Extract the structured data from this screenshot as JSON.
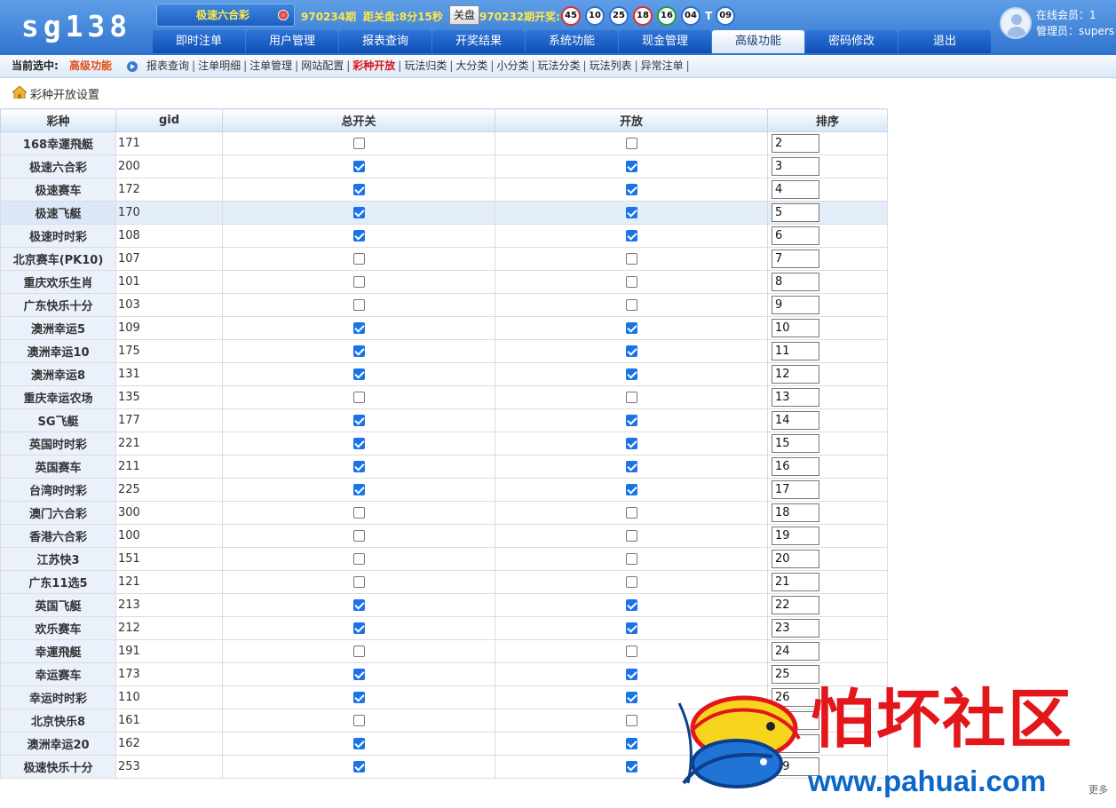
{
  "header": {
    "logo": "sg138",
    "current_game": "极速六合彩",
    "period": "970234期",
    "countdown": "距关盘:8分15秒",
    "close_button": "关盘",
    "last_draw_label": "970232期开奖:",
    "balls": [
      {
        "num": "45",
        "color": "red"
      },
      {
        "num": "10",
        "color": "blue"
      },
      {
        "num": "25",
        "color": "blue"
      },
      {
        "num": "18",
        "color": "red"
      },
      {
        "num": "16",
        "color": "green"
      },
      {
        "num": "04",
        "color": "blue"
      }
    ],
    "special_sep": "T",
    "special_ball": {
      "num": "09",
      "color": "blue"
    },
    "nav": [
      "即时注单",
      "用户管理",
      "报表查询",
      "开奖结果",
      "系统功能",
      "现金管理",
      "高级功能",
      "密码修改",
      "退出"
    ],
    "nav_active": "高级功能",
    "online_members": "在线会员：1",
    "admin": "管理员：supers"
  },
  "subbar": {
    "current_label": "当前选中:",
    "current_value": "高级功能",
    "links": [
      "报表查询",
      "注单明细",
      "注单管理",
      "网站配置",
      "彩种开放",
      "玩法归类",
      "大分类",
      "小分类",
      "玩法分类",
      "玩法列表",
      "异常注单"
    ],
    "active_link": "彩种开放"
  },
  "page": {
    "title": "彩种开放设置"
  },
  "table": {
    "headers": [
      "彩种",
      "gid",
      "总开关",
      "开放",
      "排序"
    ],
    "rows": [
      {
        "name": "168幸運飛艇",
        "gid": "171",
        "master": false,
        "open": false,
        "sort": "2"
      },
      {
        "name": "极速六合彩",
        "gid": "200",
        "master": true,
        "open": true,
        "sort": "3"
      },
      {
        "name": "极速赛车",
        "gid": "172",
        "master": true,
        "open": true,
        "sort": "4"
      },
      {
        "name": "极速飞艇",
        "gid": "170",
        "master": true,
        "open": true,
        "sort": "5"
      },
      {
        "name": "极速时时彩",
        "gid": "108",
        "master": true,
        "open": true,
        "sort": "6"
      },
      {
        "name": "北京赛车(PK10)",
        "gid": "107",
        "master": false,
        "open": false,
        "sort": "7"
      },
      {
        "name": "重庆欢乐生肖",
        "gid": "101",
        "master": false,
        "open": false,
        "sort": "8"
      },
      {
        "name": "广东快乐十分",
        "gid": "103",
        "master": false,
        "open": false,
        "sort": "9"
      },
      {
        "name": "澳洲幸运5",
        "gid": "109",
        "master": true,
        "open": true,
        "sort": "10"
      },
      {
        "name": "澳洲幸运10",
        "gid": "175",
        "master": true,
        "open": true,
        "sort": "11"
      },
      {
        "name": "澳洲幸运8",
        "gid": "131",
        "master": true,
        "open": true,
        "sort": "12"
      },
      {
        "name": "重庆幸运农场",
        "gid": "135",
        "master": false,
        "open": false,
        "sort": "13"
      },
      {
        "name": "SG飞艇",
        "gid": "177",
        "master": true,
        "open": true,
        "sort": "14"
      },
      {
        "name": "英国时时彩",
        "gid": "221",
        "master": true,
        "open": true,
        "sort": "15"
      },
      {
        "name": "英国赛车",
        "gid": "211",
        "master": true,
        "open": true,
        "sort": "16"
      },
      {
        "name": "台湾时时彩",
        "gid": "225",
        "master": true,
        "open": true,
        "sort": "17"
      },
      {
        "name": "澳门六合彩",
        "gid": "300",
        "master": false,
        "open": false,
        "sort": "18"
      },
      {
        "name": "香港六合彩",
        "gid": "100",
        "master": false,
        "open": false,
        "sort": "19"
      },
      {
        "name": "江苏快3",
        "gid": "151",
        "master": false,
        "open": false,
        "sort": "20"
      },
      {
        "name": "广东11选5",
        "gid": "121",
        "master": false,
        "open": false,
        "sort": "21"
      },
      {
        "name": "英国飞艇",
        "gid": "213",
        "master": true,
        "open": true,
        "sort": "22"
      },
      {
        "name": "欢乐赛车",
        "gid": "212",
        "master": true,
        "open": true,
        "sort": "23"
      },
      {
        "name": "幸運飛艇",
        "gid": "191",
        "master": false,
        "open": false,
        "sort": "24"
      },
      {
        "name": "幸运赛车",
        "gid": "173",
        "master": true,
        "open": true,
        "sort": "25"
      },
      {
        "name": "幸运时时彩",
        "gid": "110",
        "master": true,
        "open": true,
        "sort": "26"
      },
      {
        "name": "北京快乐8",
        "gid": "161",
        "master": false,
        "open": false,
        "sort": "27"
      },
      {
        "name": "澳洲幸运20",
        "gid": "162",
        "master": true,
        "open": true,
        "sort": "28"
      },
      {
        "name": "极速快乐十分",
        "gid": "253",
        "master": true,
        "open": true,
        "sort": "29"
      }
    ],
    "highlighted_row": 3
  },
  "watermark": {
    "text": "怕坏社区",
    "url": "www.pahuai.com"
  },
  "more_label": "更多"
}
